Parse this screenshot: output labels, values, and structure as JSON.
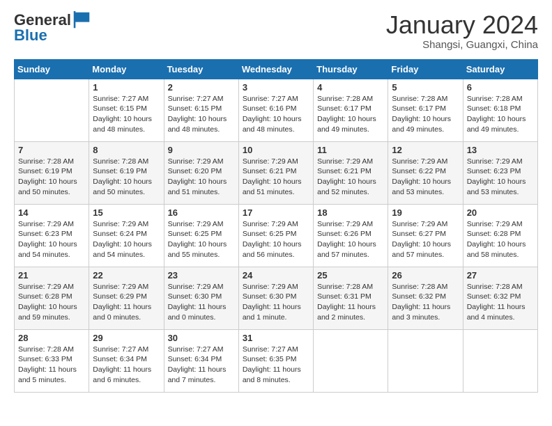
{
  "header": {
    "logo_line1": "General",
    "logo_line2": "Blue",
    "month": "January 2024",
    "location": "Shangsi, Guangxi, China"
  },
  "days_of_week": [
    "Sunday",
    "Monday",
    "Tuesday",
    "Wednesday",
    "Thursday",
    "Friday",
    "Saturday"
  ],
  "weeks": [
    [
      {
        "day": "",
        "info": ""
      },
      {
        "day": "1",
        "info": "Sunrise: 7:27 AM\nSunset: 6:15 PM\nDaylight: 10 hours and 48 minutes."
      },
      {
        "day": "2",
        "info": "Sunrise: 7:27 AM\nSunset: 6:15 PM\nDaylight: 10 hours and 48 minutes."
      },
      {
        "day": "3",
        "info": "Sunrise: 7:27 AM\nSunset: 6:16 PM\nDaylight: 10 hours and 48 minutes."
      },
      {
        "day": "4",
        "info": "Sunrise: 7:28 AM\nSunset: 6:17 PM\nDaylight: 10 hours and 49 minutes."
      },
      {
        "day": "5",
        "info": "Sunrise: 7:28 AM\nSunset: 6:17 PM\nDaylight: 10 hours and 49 minutes."
      },
      {
        "day": "6",
        "info": "Sunrise: 7:28 AM\nSunset: 6:18 PM\nDaylight: 10 hours and 49 minutes."
      }
    ],
    [
      {
        "day": "7",
        "info": "Sunrise: 7:28 AM\nSunset: 6:19 PM\nDaylight: 10 hours and 50 minutes."
      },
      {
        "day": "8",
        "info": "Sunrise: 7:28 AM\nSunset: 6:19 PM\nDaylight: 10 hours and 50 minutes."
      },
      {
        "day": "9",
        "info": "Sunrise: 7:29 AM\nSunset: 6:20 PM\nDaylight: 10 hours and 51 minutes."
      },
      {
        "day": "10",
        "info": "Sunrise: 7:29 AM\nSunset: 6:21 PM\nDaylight: 10 hours and 51 minutes."
      },
      {
        "day": "11",
        "info": "Sunrise: 7:29 AM\nSunset: 6:21 PM\nDaylight: 10 hours and 52 minutes."
      },
      {
        "day": "12",
        "info": "Sunrise: 7:29 AM\nSunset: 6:22 PM\nDaylight: 10 hours and 53 minutes."
      },
      {
        "day": "13",
        "info": "Sunrise: 7:29 AM\nSunset: 6:23 PM\nDaylight: 10 hours and 53 minutes."
      }
    ],
    [
      {
        "day": "14",
        "info": "Sunrise: 7:29 AM\nSunset: 6:23 PM\nDaylight: 10 hours and 54 minutes."
      },
      {
        "day": "15",
        "info": "Sunrise: 7:29 AM\nSunset: 6:24 PM\nDaylight: 10 hours and 54 minutes."
      },
      {
        "day": "16",
        "info": "Sunrise: 7:29 AM\nSunset: 6:25 PM\nDaylight: 10 hours and 55 minutes."
      },
      {
        "day": "17",
        "info": "Sunrise: 7:29 AM\nSunset: 6:25 PM\nDaylight: 10 hours and 56 minutes."
      },
      {
        "day": "18",
        "info": "Sunrise: 7:29 AM\nSunset: 6:26 PM\nDaylight: 10 hours and 57 minutes."
      },
      {
        "day": "19",
        "info": "Sunrise: 7:29 AM\nSunset: 6:27 PM\nDaylight: 10 hours and 57 minutes."
      },
      {
        "day": "20",
        "info": "Sunrise: 7:29 AM\nSunset: 6:28 PM\nDaylight: 10 hours and 58 minutes."
      }
    ],
    [
      {
        "day": "21",
        "info": "Sunrise: 7:29 AM\nSunset: 6:28 PM\nDaylight: 10 hours and 59 minutes."
      },
      {
        "day": "22",
        "info": "Sunrise: 7:29 AM\nSunset: 6:29 PM\nDaylight: 11 hours and 0 minutes."
      },
      {
        "day": "23",
        "info": "Sunrise: 7:29 AM\nSunset: 6:30 PM\nDaylight: 11 hours and 0 minutes."
      },
      {
        "day": "24",
        "info": "Sunrise: 7:29 AM\nSunset: 6:30 PM\nDaylight: 11 hours and 1 minute."
      },
      {
        "day": "25",
        "info": "Sunrise: 7:28 AM\nSunset: 6:31 PM\nDaylight: 11 hours and 2 minutes."
      },
      {
        "day": "26",
        "info": "Sunrise: 7:28 AM\nSunset: 6:32 PM\nDaylight: 11 hours and 3 minutes."
      },
      {
        "day": "27",
        "info": "Sunrise: 7:28 AM\nSunset: 6:32 PM\nDaylight: 11 hours and 4 minutes."
      }
    ],
    [
      {
        "day": "28",
        "info": "Sunrise: 7:28 AM\nSunset: 6:33 PM\nDaylight: 11 hours and 5 minutes."
      },
      {
        "day": "29",
        "info": "Sunrise: 7:27 AM\nSunset: 6:34 PM\nDaylight: 11 hours and 6 minutes."
      },
      {
        "day": "30",
        "info": "Sunrise: 7:27 AM\nSunset: 6:34 PM\nDaylight: 11 hours and 7 minutes."
      },
      {
        "day": "31",
        "info": "Sunrise: 7:27 AM\nSunset: 6:35 PM\nDaylight: 11 hours and 8 minutes."
      },
      {
        "day": "",
        "info": ""
      },
      {
        "day": "",
        "info": ""
      },
      {
        "day": "",
        "info": ""
      }
    ]
  ]
}
